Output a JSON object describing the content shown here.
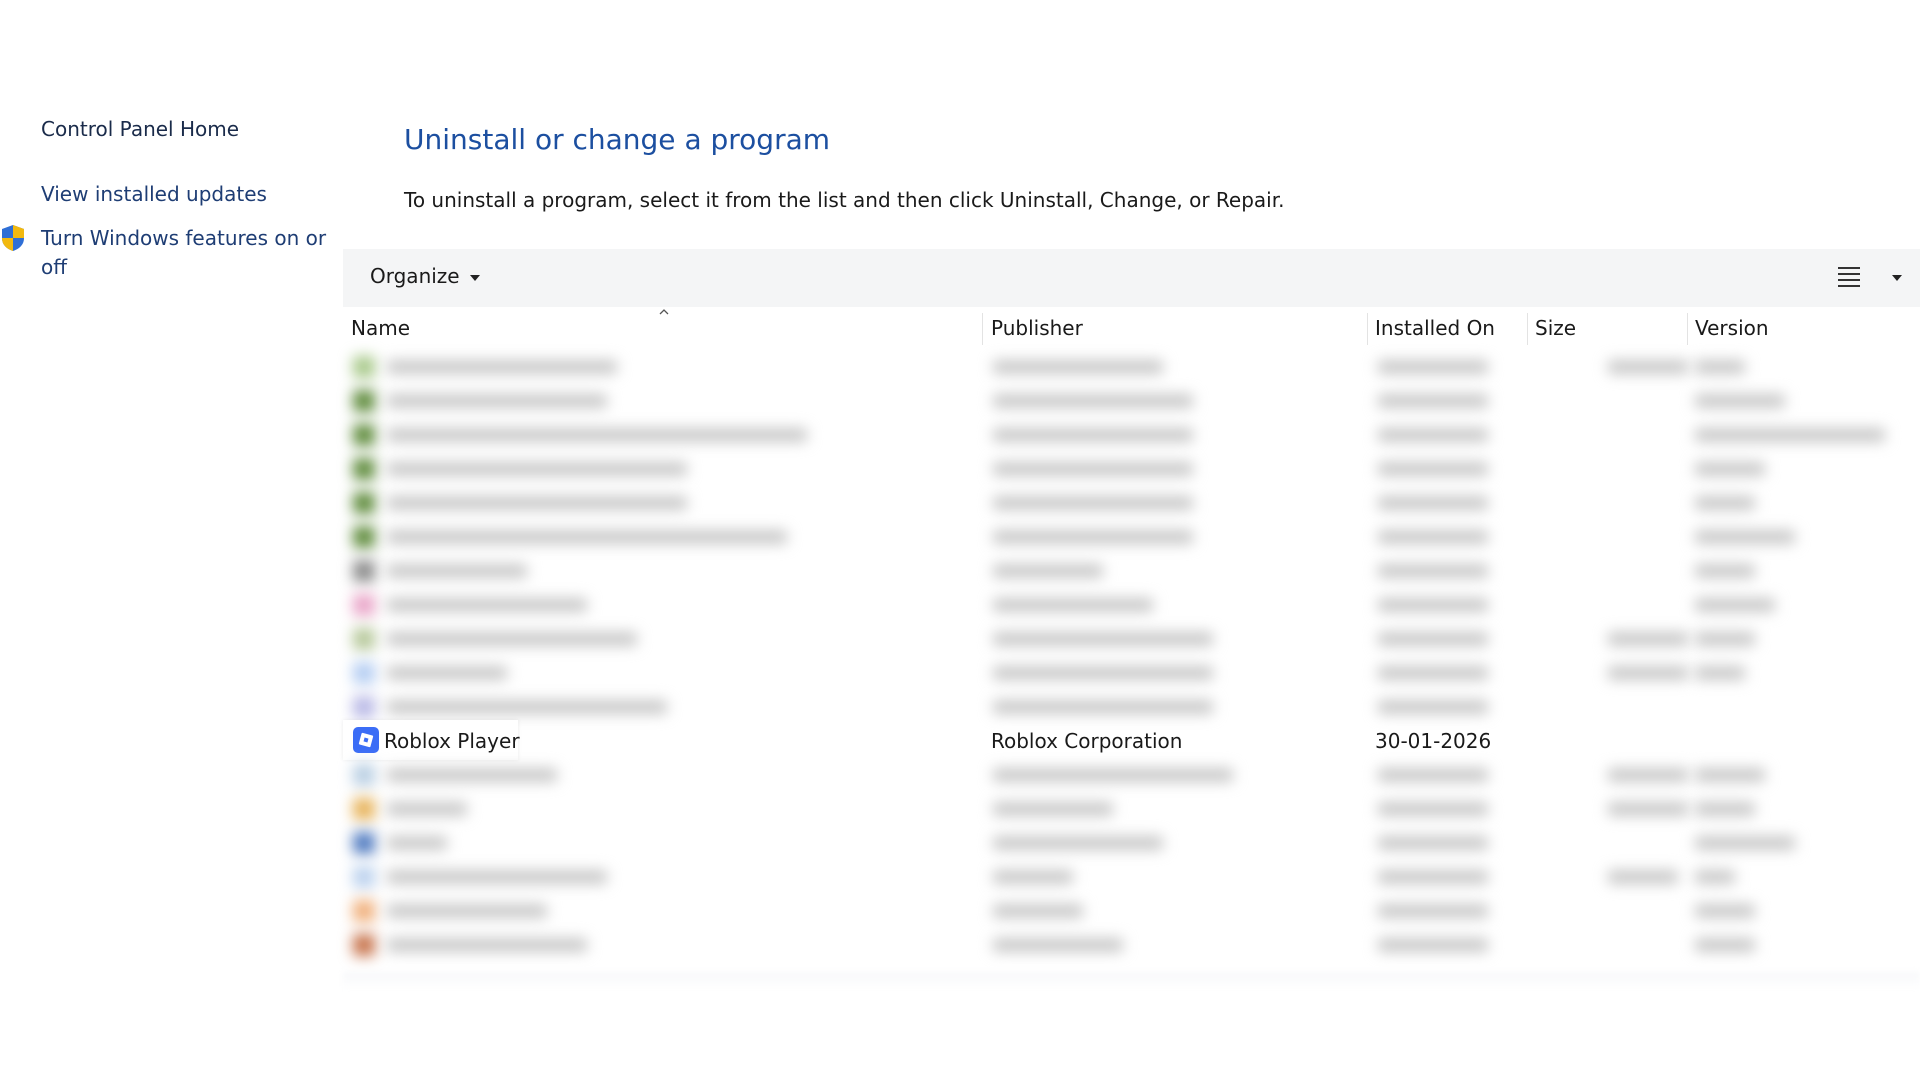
{
  "sidebar": {
    "home_label": "Control Panel Home",
    "updates_label": "View installed updates",
    "features_label": "Turn Windows features on or off",
    "features_icon": "shield-icon"
  },
  "main": {
    "title": "Uninstall or change a program",
    "description": "To uninstall a program, select it from the list and then click Uninstall, Change, or Repair."
  },
  "toolbar": {
    "organize_label": "Organize",
    "view_icon": "list-view-icon"
  },
  "columns": {
    "name": "Name",
    "publisher": "Publisher",
    "installed_on": "Installed On",
    "size": "Size",
    "version": "Version"
  },
  "programs": {
    "selected": {
      "name": "Roblox Player",
      "publisher": "Roblox Corporation",
      "installed_on": "30-01-2026",
      "size": "",
      "version": "",
      "icon": "roblox-icon",
      "icon_color": "#3b6df6"
    },
    "blurred_rows_above": 11,
    "blurred_rows_below": 6
  },
  "colors": {
    "link": "#1e3d74",
    "title": "#1c4fa0",
    "toolbar_bg": "#f4f5f6"
  }
}
